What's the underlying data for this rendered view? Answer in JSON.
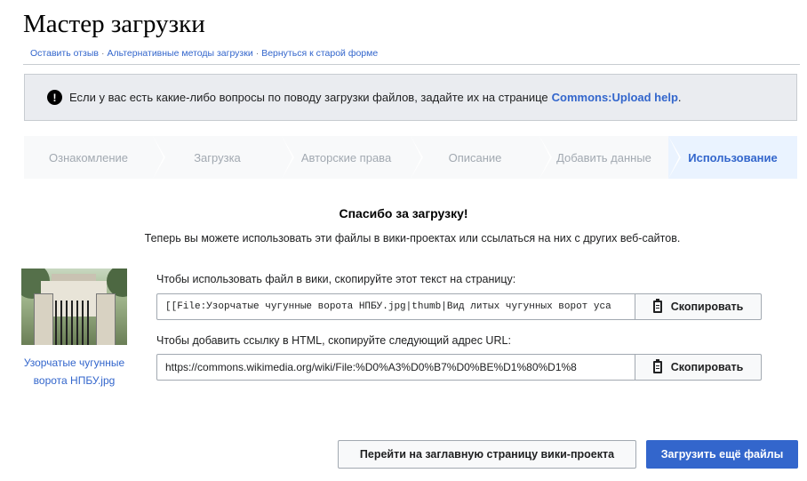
{
  "header": {
    "title": "Мастер загрузки",
    "links": [
      "Оставить отзыв",
      "Альтернативные методы загрузки",
      "Вернуться к старой форме"
    ]
  },
  "notice": {
    "icon": "exclamation-icon",
    "text": "Если у вас есть какие-либо вопросы по поводу загрузки файлов, задайте их на странице",
    "link": "Commons:Upload help",
    "suffix": "."
  },
  "steps": [
    {
      "label": "Ознакомление",
      "active": false
    },
    {
      "label": "Загрузка",
      "active": false
    },
    {
      "label": "Авторские права",
      "active": false
    },
    {
      "label": "Описание",
      "active": false
    },
    {
      "label": "Добавить данные",
      "active": false
    },
    {
      "label": "Использование",
      "active": true
    }
  ],
  "main": {
    "heading": "Спасибо за загрузку!",
    "subtext": "Теперь вы можете использовать эти файлы в вики-проектах или ссылаться на них с других веб-сайтов.",
    "file": {
      "caption": "Узорчатые чугунные ворота НПБУ.jpg"
    },
    "wiki_copy": {
      "label": "Чтобы использовать файл в вики, скопируйте этот текст на страницу:",
      "value": "[[File:Узорчатые чугунные ворота НПБУ.jpg|thumb|Вид литых чугунных ворот уса",
      "button": "Скопировать"
    },
    "url_copy": {
      "label": "Чтобы добавить ссылку в HTML, скопируйте следующий адрес URL:",
      "value": "https://commons.wikimedia.org/wiki/File:%D0%A3%D0%B7%D0%BE%D1%80%D1%8",
      "button": "Скопировать"
    }
  },
  "footer": {
    "home_button": "Перейти на заглавную страницу вики-проекта",
    "more_button": "Загрузить ещё файлы"
  },
  "colors": {
    "link": "#3366cc",
    "primary_button": "#3366cc",
    "notice_bg": "#eaecf0",
    "active_step_bg": "#eaf3ff"
  }
}
